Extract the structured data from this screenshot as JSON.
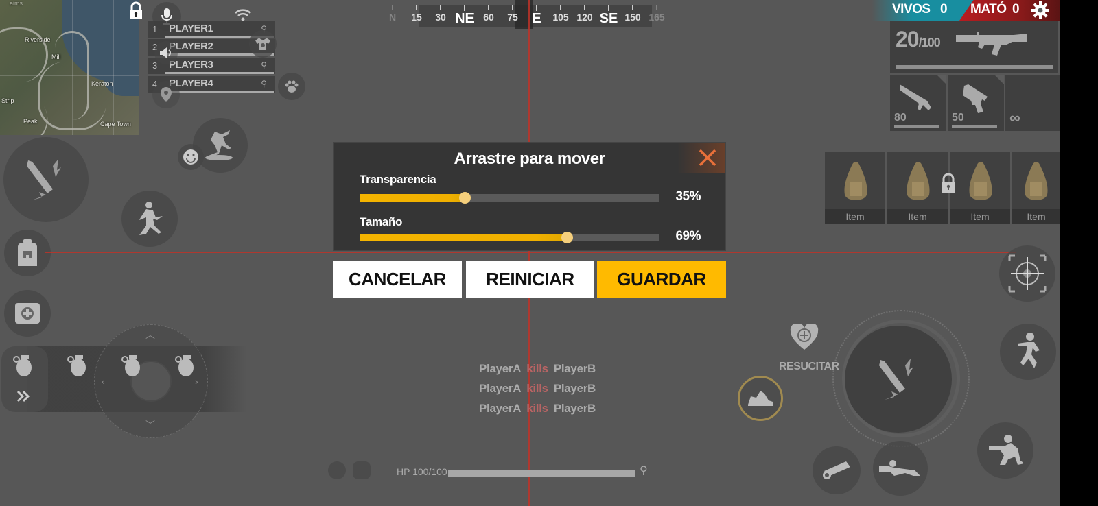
{
  "minimap": {
    "labels": [
      "Riverside",
      "Mill",
      "Keraton",
      "Strip",
      "Peak",
      "Cape Town"
    ],
    "watermark": "aims",
    "lock_icon": "lock-icon"
  },
  "comms": {
    "mic_icon": "microphone-icon",
    "speaker_icon": "speaker-icon",
    "wifi_icon": "wifi-icon"
  },
  "team": [
    {
      "num": "1",
      "name": "PLAYER1"
    },
    {
      "num": "2",
      "name": "PLAYER2"
    },
    {
      "num": "3",
      "name": "PLAYER3"
    },
    {
      "num": "4",
      "name": "PLAYER4"
    }
  ],
  "compass": {
    "ticks": [
      {
        "label": "N",
        "style": "faded"
      },
      {
        "label": "15",
        "style": "minor"
      },
      {
        "label": "30",
        "style": "minor"
      },
      {
        "label": "NE",
        "style": "major"
      },
      {
        "label": "60",
        "style": "minor"
      },
      {
        "label": "75",
        "style": "minor"
      },
      {
        "label": "E",
        "style": "major"
      },
      {
        "label": "105",
        "style": "minor"
      },
      {
        "label": "120",
        "style": "minor"
      },
      {
        "label": "SE",
        "style": "major"
      },
      {
        "label": "150",
        "style": "minor"
      },
      {
        "label": "165",
        "style": "faded"
      }
    ]
  },
  "score": {
    "alive_label": "VIVOS",
    "alive_value": "0",
    "kills_label": "MATÓ",
    "kills_value": "0"
  },
  "weapons": {
    "current_ammo": "20",
    "max_ammo": "/100",
    "slots": [
      {
        "label": "80",
        "icon": "rifle-icon"
      },
      {
        "label": "50",
        "icon": "pistol-icon"
      },
      {
        "label": "∞",
        "icon": "infinity-icon"
      }
    ]
  },
  "items": [
    {
      "label": "Item"
    },
    {
      "label": "Item"
    },
    {
      "label": "Item"
    },
    {
      "label": "Item"
    }
  ],
  "dialog": {
    "title": "Arrastre para mover",
    "sliders": [
      {
        "label": "Transparencia",
        "value": 35,
        "display": "35%"
      },
      {
        "label": "Tamaño",
        "value": 69,
        "display": "69%"
      }
    ],
    "buttons": {
      "cancel": "CANCELAR",
      "reset": "REINICIAR",
      "save": "GUARDAR"
    },
    "colors": {
      "accent": "#ffba00",
      "close": "#e8703a"
    }
  },
  "kill_feed": [
    {
      "killer": "PlayerA",
      "verb": "kills",
      "victim": "PlayerB"
    },
    {
      "killer": "PlayerA",
      "verb": "kills",
      "victim": "PlayerB"
    },
    {
      "killer": "PlayerA",
      "verb": "kills",
      "victim": "PlayerB"
    }
  ],
  "status": {
    "hp_label": "HP 100/100",
    "hp_fraction": 1.0
  },
  "actions": {
    "revive_label": "RESUCITAR"
  }
}
